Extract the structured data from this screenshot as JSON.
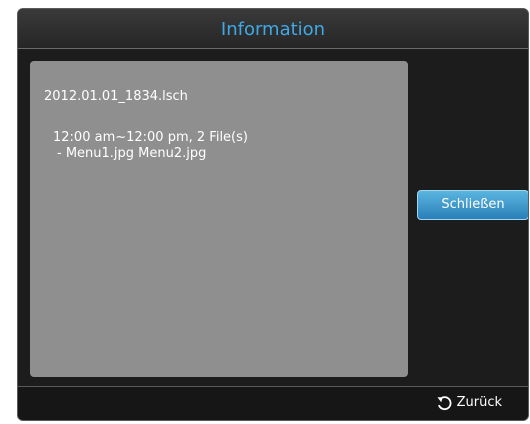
{
  "dialog": {
    "title": "Information",
    "file_name": "2012.01.01_1834.lsch",
    "schedule": "12:00 am~12:00 pm, 2 File(s)",
    "files": "- Menu1.jpg Menu2.jpg",
    "close_label": "Schließen"
  },
  "footer": {
    "back_label": "Zurück",
    "back_icon": "return-icon"
  },
  "colors": {
    "title": "#3fa9e6",
    "panel": "#8f8f8f",
    "button": "#2a7fb8",
    "background": "#1c1c1c"
  }
}
